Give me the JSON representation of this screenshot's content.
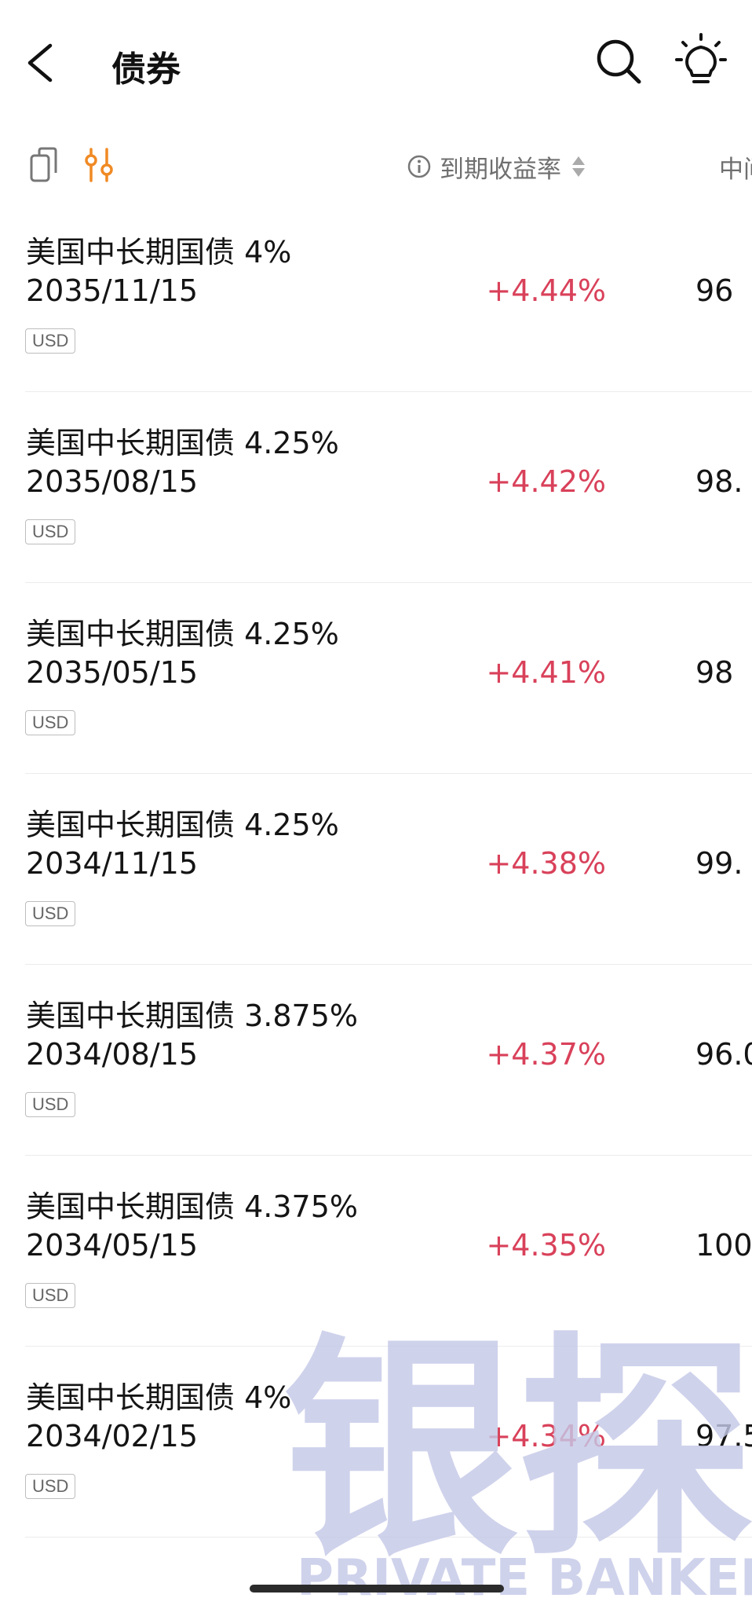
{
  "header": {
    "title": "债券"
  },
  "toolbar": {
    "column_yield": "到期收益率",
    "column_price": "中间"
  },
  "bonds": [
    {
      "name": "美国中长期国债 4%",
      "date": "2035/11/15",
      "currency": "USD",
      "yield": "+4.44%",
      "price": "96"
    },
    {
      "name": "美国中长期国债 4.25%",
      "date": "2035/08/15",
      "currency": "USD",
      "yield": "+4.42%",
      "price": "98."
    },
    {
      "name": "美国中长期国债 4.25%",
      "date": "2035/05/15",
      "currency": "USD",
      "yield": "+4.41%",
      "price": "98"
    },
    {
      "name": "美国中长期国债 4.25%",
      "date": "2034/11/15",
      "currency": "USD",
      "yield": "+4.38%",
      "price": "99."
    },
    {
      "name": "美国中长期国债 3.875%",
      "date": "2034/08/15",
      "currency": "USD",
      "yield": "+4.37%",
      "price": "96.0"
    },
    {
      "name": "美国中长期国债 4.375%",
      "date": "2034/05/15",
      "currency": "USD",
      "yield": "+4.35%",
      "price": "100"
    },
    {
      "name": "美国中长期国债 4%",
      "date": "2034/02/15",
      "currency": "USD",
      "yield": "+4.34%",
      "price": "97.5"
    }
  ],
  "watermark": {
    "chinese": "银探",
    "english": "PRIVATE BANKER"
  },
  "colors": {
    "accent": "#f08a24",
    "positive": "#d9415a",
    "watermark": "#c5c8e6"
  },
  "icons": [
    "back-arrow-icon",
    "search-icon",
    "lightbulb-icon",
    "copy-icon",
    "filter-icon",
    "info-icon",
    "sort-icon"
  ]
}
